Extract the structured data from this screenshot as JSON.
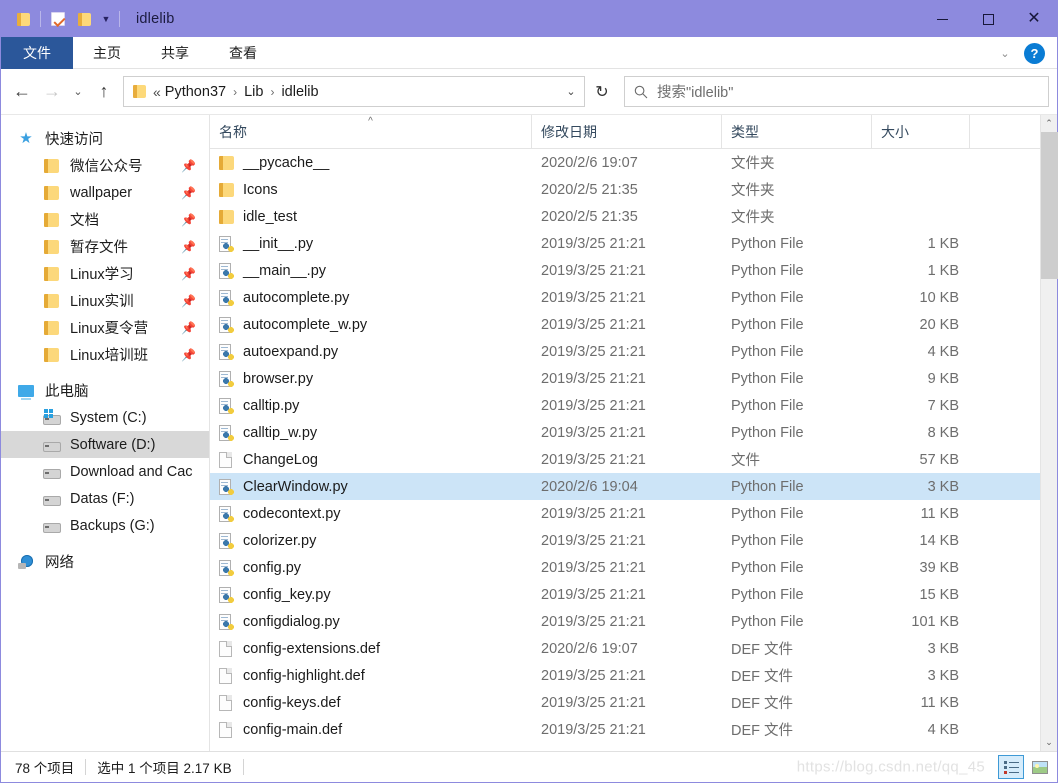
{
  "window": {
    "title": "idlelib",
    "quick_access_icons": [
      "folder-icon",
      "properties-checkbox-icon",
      "new-folder-icon",
      "customize-caret-icon"
    ],
    "controls": {
      "minimize": "—",
      "maximize": "□",
      "close": "✕"
    }
  },
  "ribbon": {
    "tabs": [
      {
        "label": "文件",
        "name": "tab-file",
        "active": true
      },
      {
        "label": "主页",
        "name": "tab-home",
        "active": false
      },
      {
        "label": "共享",
        "name": "tab-share",
        "active": false
      },
      {
        "label": "查看",
        "name": "tab-view",
        "active": false
      }
    ],
    "expand_caret": "⌄",
    "help_label": "?"
  },
  "navigation": {
    "back": "←",
    "forward": "→",
    "recent": "⌄",
    "up": "↑",
    "refresh": "↻",
    "address_prefix": "«",
    "breadcrumbs": [
      "Python37",
      "Lib",
      "idlelib"
    ],
    "breadcrumb_separator": "›",
    "address_dropdown": "⌄"
  },
  "search": {
    "icon": "search-icon",
    "placeholder": "搜索\"idlelib\""
  },
  "sidebar": {
    "groups": [
      {
        "name": "quick-access",
        "label": "快速访问",
        "icon": "star-icon",
        "items": [
          {
            "label": "微信公众号",
            "icon": "folder-icon",
            "pinned": true
          },
          {
            "label": "wallpaper",
            "icon": "folder-icon",
            "pinned": true
          },
          {
            "label": "文档",
            "icon": "folder-icon",
            "pinned": true
          },
          {
            "label": "暂存文件",
            "icon": "folder-icon",
            "pinned": true
          },
          {
            "label": "Linux学习",
            "icon": "folder-icon",
            "pinned": true
          },
          {
            "label": "Linux实训",
            "icon": "folder-icon",
            "pinned": true
          },
          {
            "label": "Linux夏令营",
            "icon": "folder-icon",
            "pinned": true
          },
          {
            "label": "Linux培训班",
            "icon": "folder-icon",
            "pinned": true
          }
        ]
      },
      {
        "name": "this-pc",
        "label": "此电脑",
        "icon": "computer-icon",
        "items": [
          {
            "label": "System (C:)",
            "icon": "system-drive-icon",
            "selected": false
          },
          {
            "label": "Software (D:)",
            "icon": "drive-icon",
            "selected": true
          },
          {
            "label": "Download and Cac",
            "icon": "drive-icon",
            "selected": false
          },
          {
            "label": "Datas (F:)",
            "icon": "drive-icon",
            "selected": false
          },
          {
            "label": "Backups (G:)",
            "icon": "drive-icon",
            "selected": false
          }
        ]
      },
      {
        "name": "network",
        "label": "网络",
        "icon": "network-icon",
        "items": []
      }
    ]
  },
  "filelist": {
    "columns": [
      {
        "label": "名称",
        "name": "column-name",
        "sorted": true,
        "sort_mark": "^"
      },
      {
        "label": "修改日期",
        "name": "column-date-modified"
      },
      {
        "label": "类型",
        "name": "column-type"
      },
      {
        "label": "大小",
        "name": "column-size"
      }
    ],
    "rows": [
      {
        "name": "__pycache__",
        "date": "2020/2/6 19:07",
        "type": "文件夹",
        "size": "",
        "icon": "folder-icon",
        "selected": false
      },
      {
        "name": "Icons",
        "date": "2020/2/5 21:35",
        "type": "文件夹",
        "size": "",
        "icon": "folder-icon",
        "selected": false
      },
      {
        "name": "idle_test",
        "date": "2020/2/5 21:35",
        "type": "文件夹",
        "size": "",
        "icon": "folder-icon",
        "selected": false
      },
      {
        "name": "__init__.py",
        "date": "2019/3/25 21:21",
        "type": "Python File",
        "size": "1 KB",
        "icon": "python-file-icon",
        "selected": false
      },
      {
        "name": "__main__.py",
        "date": "2019/3/25 21:21",
        "type": "Python File",
        "size": "1 KB",
        "icon": "python-file-icon",
        "selected": false
      },
      {
        "name": "autocomplete.py",
        "date": "2019/3/25 21:21",
        "type": "Python File",
        "size": "10 KB",
        "icon": "python-file-icon",
        "selected": false
      },
      {
        "name": "autocomplete_w.py",
        "date": "2019/3/25 21:21",
        "type": "Python File",
        "size": "20 KB",
        "icon": "python-file-icon",
        "selected": false
      },
      {
        "name": "autoexpand.py",
        "date": "2019/3/25 21:21",
        "type": "Python File",
        "size": "4 KB",
        "icon": "python-file-icon",
        "selected": false
      },
      {
        "name": "browser.py",
        "date": "2019/3/25 21:21",
        "type": "Python File",
        "size": "9 KB",
        "icon": "python-file-icon",
        "selected": false
      },
      {
        "name": "calltip.py",
        "date": "2019/3/25 21:21",
        "type": "Python File",
        "size": "7 KB",
        "icon": "python-file-icon",
        "selected": false
      },
      {
        "name": "calltip_w.py",
        "date": "2019/3/25 21:21",
        "type": "Python File",
        "size": "8 KB",
        "icon": "python-file-icon",
        "selected": false
      },
      {
        "name": "ChangeLog",
        "date": "2019/3/25 21:21",
        "type": "文件",
        "size": "57 KB",
        "icon": "generic-file-icon",
        "selected": false
      },
      {
        "name": "ClearWindow.py",
        "date": "2020/2/6 19:04",
        "type": "Python File",
        "size": "3 KB",
        "icon": "python-file-icon",
        "selected": true
      },
      {
        "name": "codecontext.py",
        "date": "2019/3/25 21:21",
        "type": "Python File",
        "size": "11 KB",
        "icon": "python-file-icon",
        "selected": false
      },
      {
        "name": "colorizer.py",
        "date": "2019/3/25 21:21",
        "type": "Python File",
        "size": "14 KB",
        "icon": "python-file-icon",
        "selected": false
      },
      {
        "name": "config.py",
        "date": "2019/3/25 21:21",
        "type": "Python File",
        "size": "39 KB",
        "icon": "python-file-icon",
        "selected": false
      },
      {
        "name": "config_key.py",
        "date": "2019/3/25 21:21",
        "type": "Python File",
        "size": "15 KB",
        "icon": "python-file-icon",
        "selected": false
      },
      {
        "name": "configdialog.py",
        "date": "2019/3/25 21:21",
        "type": "Python File",
        "size": "101 KB",
        "icon": "python-file-icon",
        "selected": false
      },
      {
        "name": "config-extensions.def",
        "date": "2020/2/6 19:07",
        "type": "DEF 文件",
        "size": "3 KB",
        "icon": "generic-file-icon",
        "selected": false
      },
      {
        "name": "config-highlight.def",
        "date": "2019/3/25 21:21",
        "type": "DEF 文件",
        "size": "3 KB",
        "icon": "generic-file-icon",
        "selected": false
      },
      {
        "name": "config-keys.def",
        "date": "2019/3/25 21:21",
        "type": "DEF 文件",
        "size": "11 KB",
        "icon": "generic-file-icon",
        "selected": false
      },
      {
        "name": "config-main.def",
        "date": "2019/3/25 21:21",
        "type": "DEF 文件",
        "size": "4 KB",
        "icon": "generic-file-icon",
        "selected": false
      }
    ],
    "scrollbar": {
      "up_arrow": "⌃",
      "down_arrow": "⌄"
    }
  },
  "statusbar": {
    "item_count": "78 个项目",
    "selection": "选中 1 个项目  2.17 KB",
    "watermark": "https://blog.csdn.net/qq_45",
    "view_buttons": [
      {
        "name": "details-view-button",
        "icon": "details-view-icon",
        "active": true
      },
      {
        "name": "thumbnail-view-button",
        "icon": "thumbnail-view-icon",
        "active": false
      }
    ]
  },
  "colors": {
    "titlebar": "#8d8ade",
    "file_tab": "#2b579a",
    "selection": "#cce4f7",
    "nav_selection": "#d8d8d8",
    "accent_help": "#0a7cd4"
  }
}
